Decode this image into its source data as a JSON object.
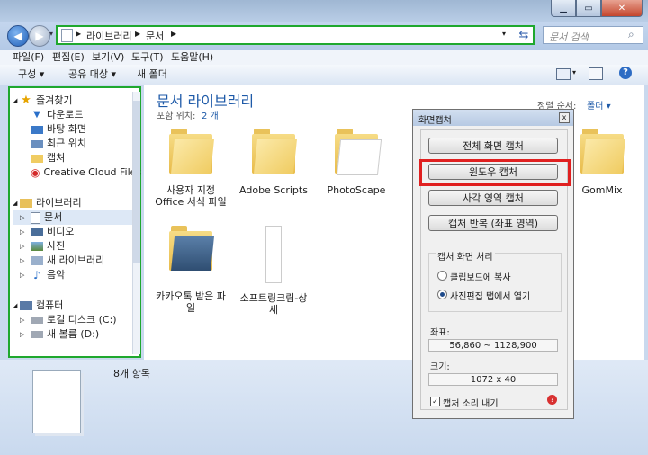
{
  "address": {
    "crumbs": [
      "라이브러리",
      "문서"
    ],
    "search_placeholder": "문서 검색"
  },
  "menu": [
    "파일(F)",
    "편집(E)",
    "보기(V)",
    "도구(T)",
    "도움말(H)"
  ],
  "toolbar": {
    "organize": "구성 ▾",
    "share": "공유 대상 ▾",
    "new_folder": "새 폴더"
  },
  "nav": {
    "favorites": "즐겨찾기",
    "fav_items": [
      "다운로드",
      "바탕 화면",
      "최근 위치",
      "캡쳐",
      "Creative Cloud Files"
    ],
    "libraries": "라이브러리",
    "lib_items": [
      "문서",
      "비디오",
      "사진",
      "새 라이브러리",
      "음악"
    ],
    "computer": "컴퓨터",
    "comp_items": [
      "로컬 디스크 (C:)",
      "새 볼륨 (D:)"
    ]
  },
  "content": {
    "title": "문서 라이브러리",
    "subtitle_prefix": "포함 위치:",
    "subtitle_count": "2 개",
    "sort_label": "정렬 순서:",
    "sort_value": "폴더 ▾",
    "files": [
      {
        "name": "사용자 지정 Office 서식 파일"
      },
      {
        "name": "Adobe Scripts"
      },
      {
        "name": "PhotoScape"
      },
      {
        "name": "GomMix"
      },
      {
        "name": "카카오톡 받은 파일"
      },
      {
        "name": "소프트링크림-상세"
      }
    ]
  },
  "details": {
    "item_count": "8개 항목"
  },
  "dialog": {
    "title": "화면캡쳐",
    "btn_full": "전체 화면 캡처",
    "btn_window": "윈도우 캡처",
    "btn_area": "사각 영역 캡처",
    "btn_repeat": "캡처 반복 (좌표 영역)",
    "group_title": "캡처 화면 처리",
    "opt_clipboard": "클립보드에 복사",
    "opt_editor": "사진편집 탭에서 열기",
    "coord_label": "좌표:",
    "coord_value": "56,860 ~ 1128,900",
    "size_label": "크기:",
    "size_value": "1072 x 40",
    "sound_label": "캡처 소리 내기",
    "close": "x"
  },
  "colors": {
    "highlight_green": "#1fa82e",
    "highlight_red": "#e02020",
    "title_blue": "#1e5aa8"
  }
}
